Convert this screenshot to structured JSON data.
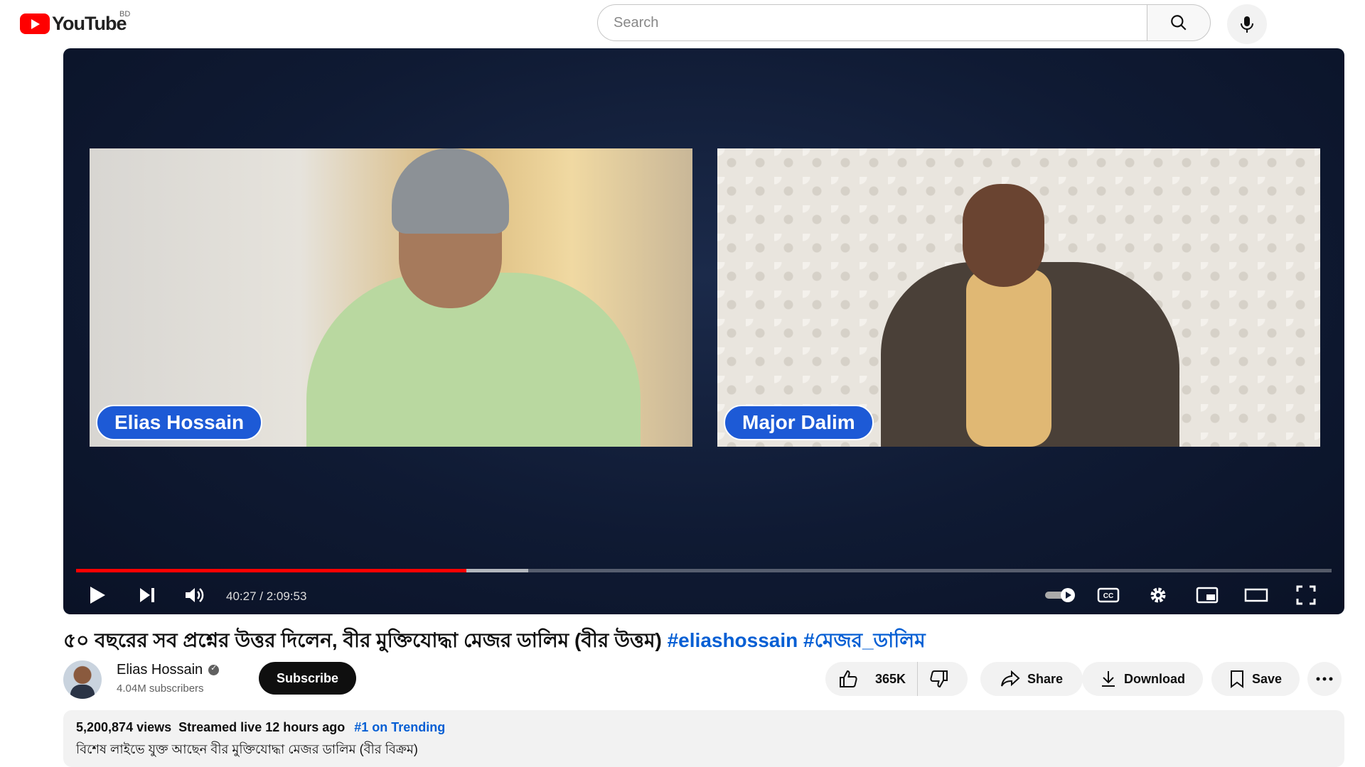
{
  "header": {
    "logo_text": "YouTube",
    "region": "BD",
    "search_placeholder": "Search"
  },
  "player": {
    "left_name": "Elias Hossain",
    "right_name": "Major Dalim",
    "current_time": "40:27",
    "duration": "2:09:53",
    "time_display": "40:27 / 2:09:53",
    "progress_fraction": 0.311,
    "buffer_fraction": 0.36
  },
  "video": {
    "title_text": "৫০ বছরের সব প্রশ্নের উত্তর দিলেন, বীর মুক্তিযোদ্ধা মেজর ডালিম (বীর উত্তম) ",
    "hashtags": "#eliashossain #মেজর_ডালিম"
  },
  "channel": {
    "name": "Elias Hossain",
    "subscribers": "4.04M subscribers",
    "subscribe_label": "Subscribe"
  },
  "actions": {
    "likes": "365K",
    "share": "Share",
    "download": "Download",
    "save": "Save"
  },
  "description": {
    "views": "5,200,874 views",
    "streamed": "Streamed live 12 hours ago",
    "trending": "#1 on Trending",
    "text": "বিশেষ লাইভে যুক্ত আছেন বীর মুক্তিযোদ্ধা মেজর ডালিম (বীর বিক্রম)"
  },
  "colors": {
    "brand_red": "#ff0000",
    "link_blue": "#065fd4",
    "name_tag_blue": "#1d5ad6"
  }
}
